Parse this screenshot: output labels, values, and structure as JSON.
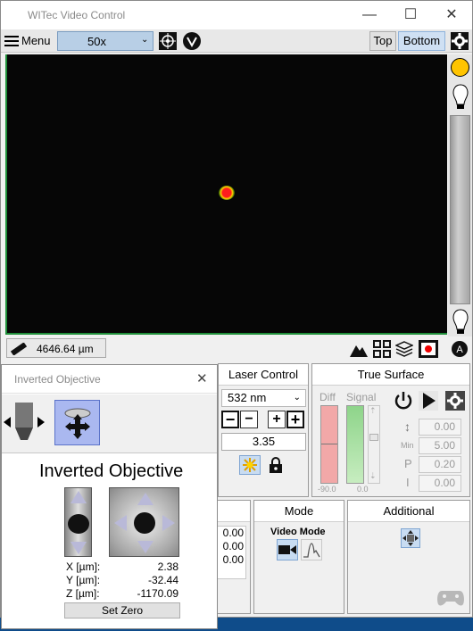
{
  "window": {
    "title": "WITec Video Control"
  },
  "toolbar": {
    "menu_label": "Menu",
    "objective_value": "50x",
    "top_label": "Top",
    "bottom_label": "Bottom"
  },
  "status": {
    "scale_value": "4646.64 µm"
  },
  "inverted_objective": {
    "window_title": "Inverted Objective",
    "heading": "Inverted Objective",
    "x_label": "X [µm]:",
    "x_value": "2.38",
    "y_label": "Y [µm]:",
    "y_value": "-32.44",
    "z_label": "Z [µm]:",
    "z_value": "-1170.09",
    "set_zero_label": "Set Zero"
  },
  "laser_control": {
    "title": "Laser Control",
    "wavelength": "532 nm",
    "power_value": "3.35"
  },
  "true_surface": {
    "title": "True Surface",
    "diff_label": "Diff",
    "signal_label": "Signal",
    "diff_value": "-90.0",
    "signal_value": "0.0",
    "value_top": "0.00",
    "min_label": "Min",
    "min_value": "5.00",
    "p_label": "P",
    "p_value": "0.20",
    "i_label": "I",
    "i_value": "0.00"
  },
  "partial_panel": {
    "values": [
      "0.00",
      "0.00",
      "0.00"
    ]
  },
  "mode": {
    "title": "Mode",
    "video_mode_label": "Video Mode"
  },
  "additional": {
    "title": "Additional"
  },
  "colors": {
    "accent": "#cfe0f3",
    "laser_spot": "#ff1d1d",
    "frame_green": "#1f8f3a"
  }
}
